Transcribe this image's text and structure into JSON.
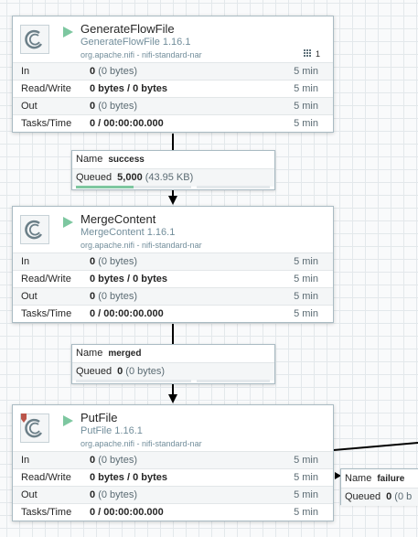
{
  "colors": {
    "running": "#7dc7a0",
    "secondary_text": "#728e9b",
    "connector": "#000000",
    "backpressure_ok": "#7dc7a0"
  },
  "processors": [
    {
      "name": "GenerateFlowFile",
      "type": "GenerateFlowFile 1.16.1",
      "bundle": "org.apache.nifi - nifi-standard-nar",
      "status_icon": "play-icon",
      "active_tasks": "1",
      "restricted": false,
      "stats": {
        "in": {
          "label": "In",
          "value": "0",
          "sub": "(0 bytes)",
          "window": "5 min"
        },
        "rw": {
          "label": "Read/Write",
          "value": "0 bytes / 0 bytes",
          "window": "5 min"
        },
        "out": {
          "label": "Out",
          "value": "0",
          "sub": "(0 bytes)",
          "window": "5 min"
        },
        "tasks": {
          "label": "Tasks/Time",
          "value": "0 / 00:00:00.000",
          "window": "5 min"
        }
      }
    },
    {
      "name": "MergeContent",
      "type": "MergeContent 1.16.1",
      "bundle": "org.apache.nifi - nifi-standard-nar",
      "status_icon": "play-icon",
      "restricted": false,
      "stats": {
        "in": {
          "label": "In",
          "value": "0",
          "sub": "(0 bytes)",
          "window": "5 min"
        },
        "rw": {
          "label": "Read/Write",
          "value": "0 bytes / 0 bytes",
          "window": "5 min"
        },
        "out": {
          "label": "Out",
          "value": "0",
          "sub": "(0 bytes)",
          "window": "5 min"
        },
        "tasks": {
          "label": "Tasks/Time",
          "value": "0 / 00:00:00.000",
          "window": "5 min"
        }
      }
    },
    {
      "name": "PutFile",
      "type": "PutFile 1.16.1",
      "bundle": "org.apache.nifi - nifi-standard-nar",
      "status_icon": "play-icon",
      "restricted": true,
      "stats": {
        "in": {
          "label": "In",
          "value": "0",
          "sub": "(0 bytes)",
          "window": "5 min"
        },
        "rw": {
          "label": "Read/Write",
          "value": "0 bytes / 0 bytes",
          "window": "5 min"
        },
        "out": {
          "label": "Out",
          "value": "0",
          "sub": "(0 bytes)",
          "window": "5 min"
        },
        "tasks": {
          "label": "Tasks/Time",
          "value": "0 / 00:00:00.000",
          "window": "5 min"
        }
      }
    }
  ],
  "connections": [
    {
      "name_label": "Name",
      "name": "success",
      "queued_label": "Queued",
      "queued_count": "5,000",
      "queued_size": "(43.95 KB)",
      "backpressure_count_fraction": 0.5,
      "backpressure_size_fraction": 0.0
    },
    {
      "name_label": "Name",
      "name": "merged",
      "queued_label": "Queued",
      "queued_count": "0",
      "queued_size": "(0 bytes)",
      "backpressure_count_fraction": 0.0,
      "backpressure_size_fraction": 0.0
    },
    {
      "name_label": "Name",
      "name": "failure",
      "queued_label": "Queued",
      "queued_count": "0",
      "queued_size": "(0 b"
    }
  ]
}
